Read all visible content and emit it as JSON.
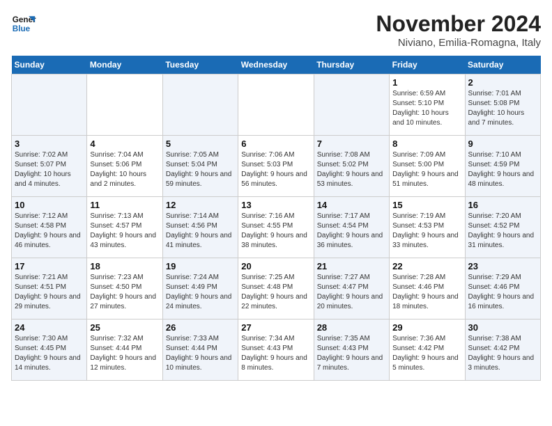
{
  "header": {
    "logo_line1": "General",
    "logo_line2": "Blue",
    "month": "November 2024",
    "location": "Niviano, Emilia-Romagna, Italy"
  },
  "weekdays": [
    "Sunday",
    "Monday",
    "Tuesday",
    "Wednesday",
    "Thursday",
    "Friday",
    "Saturday"
  ],
  "weeks": [
    [
      {
        "day": "",
        "info": ""
      },
      {
        "day": "",
        "info": ""
      },
      {
        "day": "",
        "info": ""
      },
      {
        "day": "",
        "info": ""
      },
      {
        "day": "",
        "info": ""
      },
      {
        "day": "1",
        "info": "Sunrise: 6:59 AM\nSunset: 5:10 PM\nDaylight: 10 hours and 10 minutes."
      },
      {
        "day": "2",
        "info": "Sunrise: 7:01 AM\nSunset: 5:08 PM\nDaylight: 10 hours and 7 minutes."
      }
    ],
    [
      {
        "day": "3",
        "info": "Sunrise: 7:02 AM\nSunset: 5:07 PM\nDaylight: 10 hours and 4 minutes."
      },
      {
        "day": "4",
        "info": "Sunrise: 7:04 AM\nSunset: 5:06 PM\nDaylight: 10 hours and 2 minutes."
      },
      {
        "day": "5",
        "info": "Sunrise: 7:05 AM\nSunset: 5:04 PM\nDaylight: 9 hours and 59 minutes."
      },
      {
        "day": "6",
        "info": "Sunrise: 7:06 AM\nSunset: 5:03 PM\nDaylight: 9 hours and 56 minutes."
      },
      {
        "day": "7",
        "info": "Sunrise: 7:08 AM\nSunset: 5:02 PM\nDaylight: 9 hours and 53 minutes."
      },
      {
        "day": "8",
        "info": "Sunrise: 7:09 AM\nSunset: 5:00 PM\nDaylight: 9 hours and 51 minutes."
      },
      {
        "day": "9",
        "info": "Sunrise: 7:10 AM\nSunset: 4:59 PM\nDaylight: 9 hours and 48 minutes."
      }
    ],
    [
      {
        "day": "10",
        "info": "Sunrise: 7:12 AM\nSunset: 4:58 PM\nDaylight: 9 hours and 46 minutes."
      },
      {
        "day": "11",
        "info": "Sunrise: 7:13 AM\nSunset: 4:57 PM\nDaylight: 9 hours and 43 minutes."
      },
      {
        "day": "12",
        "info": "Sunrise: 7:14 AM\nSunset: 4:56 PM\nDaylight: 9 hours and 41 minutes."
      },
      {
        "day": "13",
        "info": "Sunrise: 7:16 AM\nSunset: 4:55 PM\nDaylight: 9 hours and 38 minutes."
      },
      {
        "day": "14",
        "info": "Sunrise: 7:17 AM\nSunset: 4:54 PM\nDaylight: 9 hours and 36 minutes."
      },
      {
        "day": "15",
        "info": "Sunrise: 7:19 AM\nSunset: 4:53 PM\nDaylight: 9 hours and 33 minutes."
      },
      {
        "day": "16",
        "info": "Sunrise: 7:20 AM\nSunset: 4:52 PM\nDaylight: 9 hours and 31 minutes."
      }
    ],
    [
      {
        "day": "17",
        "info": "Sunrise: 7:21 AM\nSunset: 4:51 PM\nDaylight: 9 hours and 29 minutes."
      },
      {
        "day": "18",
        "info": "Sunrise: 7:23 AM\nSunset: 4:50 PM\nDaylight: 9 hours and 27 minutes."
      },
      {
        "day": "19",
        "info": "Sunrise: 7:24 AM\nSunset: 4:49 PM\nDaylight: 9 hours and 24 minutes."
      },
      {
        "day": "20",
        "info": "Sunrise: 7:25 AM\nSunset: 4:48 PM\nDaylight: 9 hours and 22 minutes."
      },
      {
        "day": "21",
        "info": "Sunrise: 7:27 AM\nSunset: 4:47 PM\nDaylight: 9 hours and 20 minutes."
      },
      {
        "day": "22",
        "info": "Sunrise: 7:28 AM\nSunset: 4:46 PM\nDaylight: 9 hours and 18 minutes."
      },
      {
        "day": "23",
        "info": "Sunrise: 7:29 AM\nSunset: 4:46 PM\nDaylight: 9 hours and 16 minutes."
      }
    ],
    [
      {
        "day": "24",
        "info": "Sunrise: 7:30 AM\nSunset: 4:45 PM\nDaylight: 9 hours and 14 minutes."
      },
      {
        "day": "25",
        "info": "Sunrise: 7:32 AM\nSunset: 4:44 PM\nDaylight: 9 hours and 12 minutes."
      },
      {
        "day": "26",
        "info": "Sunrise: 7:33 AM\nSunset: 4:44 PM\nDaylight: 9 hours and 10 minutes."
      },
      {
        "day": "27",
        "info": "Sunrise: 7:34 AM\nSunset: 4:43 PM\nDaylight: 9 hours and 8 minutes."
      },
      {
        "day": "28",
        "info": "Sunrise: 7:35 AM\nSunset: 4:43 PM\nDaylight: 9 hours and 7 minutes."
      },
      {
        "day": "29",
        "info": "Sunrise: 7:36 AM\nSunset: 4:42 PM\nDaylight: 9 hours and 5 minutes."
      },
      {
        "day": "30",
        "info": "Sunrise: 7:38 AM\nSunset: 4:42 PM\nDaylight: 9 hours and 3 minutes."
      }
    ]
  ]
}
